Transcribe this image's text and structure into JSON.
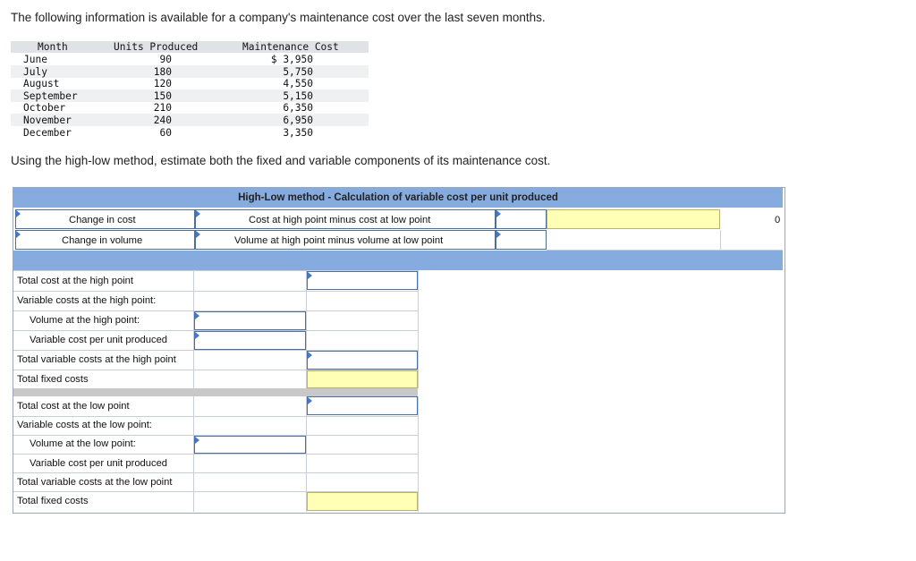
{
  "intro": "The following information is available for a company's maintenance cost over the last seven months.",
  "data_table": {
    "headers": {
      "month": "Month",
      "units": "Units Produced",
      "cost": "Maintenance Cost"
    },
    "rows": [
      {
        "month": "June",
        "units": "90",
        "cost": "$ 3,950"
      },
      {
        "month": "July",
        "units": "180",
        "cost": "5,750"
      },
      {
        "month": "August",
        "units": "120",
        "cost": "4,550"
      },
      {
        "month": "September",
        "units": "150",
        "cost": "5,150"
      },
      {
        "month": "October",
        "units": "210",
        "cost": "6,350"
      },
      {
        "month": "November",
        "units": "240",
        "cost": "6,950"
      },
      {
        "month": "December",
        "units": "60",
        "cost": "3,350"
      }
    ]
  },
  "question": "Using the high-low method, estimate both the fixed and variable components of its maintenance cost.",
  "worksheet": {
    "title": "High-Low method - Calculation of variable cost per unit produced",
    "change_in_cost": "Change in cost",
    "change_in_volume": "Change in volume",
    "cost_desc": "Cost at high point minus cost at low point",
    "volume_desc": "Volume at high point minus volume at low point",
    "result_value": "0",
    "high": {
      "total_cost": "Total cost at the high point",
      "var_costs": "Variable costs at the high point:",
      "volume": "Volume at the high point:",
      "var_cost_per_unit": "Variable cost per unit produced",
      "total_var_costs": "Total variable costs at the high point",
      "total_fixed": "Total fixed costs"
    },
    "low": {
      "total_cost": "Total cost at the low point",
      "var_costs": "Variable costs at the low point:",
      "volume": "Volume at the low point:",
      "var_cost_per_unit": "Variable cost per unit produced",
      "total_var_costs": "Total variable costs at the low point",
      "total_fixed": "Total fixed costs"
    }
  },
  "colors": {
    "header_band": "#86abde",
    "input_border": "#4a6fa5",
    "yellow_cell": "#ffffb5"
  }
}
